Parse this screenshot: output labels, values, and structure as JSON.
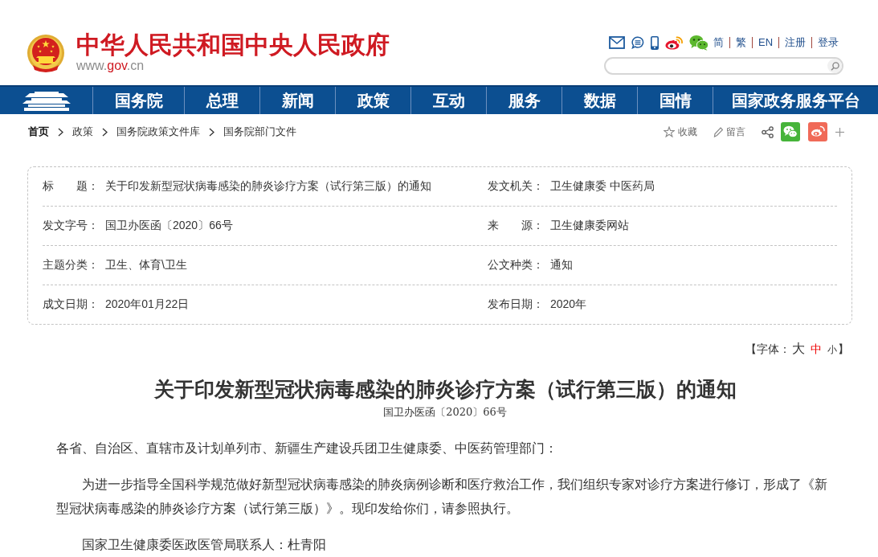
{
  "header": {
    "site_title": "中华人民共和国中央人民政府",
    "site_url": "www.gov.cn",
    "links": [
      "简",
      "繁",
      "EN",
      "注册",
      "登录"
    ]
  },
  "nav": {
    "items": [
      "国务院",
      "总理",
      "新闻",
      "政策",
      "互动",
      "服务",
      "数据",
      "国情",
      "国家政务服务平台"
    ]
  },
  "breadcrumb": {
    "items": [
      "首页",
      "政策",
      "国务院政策文件库",
      "国务院部门文件"
    ],
    "actions": [
      "收藏",
      "留言"
    ]
  },
  "info": {
    "rows": [
      {
        "fields": [
          {
            "label": "标　　题：",
            "value": "关于印发新型冠状病毒感染的肺炎诊疗方案（试行第三版）的通知"
          },
          {
            "label": "发文机关：",
            "value": "卫生健康委 中医药局"
          }
        ]
      },
      {
        "fields": [
          {
            "label": "发文字号：",
            "value": "国卫办医函〔2020〕66号"
          },
          {
            "label": "来　　源：",
            "value": "卫生健康委网站"
          }
        ]
      },
      {
        "fields": [
          {
            "label": "主题分类：",
            "value": "卫生、体育\\卫生"
          },
          {
            "label": "公文种类：",
            "value": "通知"
          }
        ]
      },
      {
        "fields": [
          {
            "label": "成文日期：",
            "value": "2020年01月22日"
          },
          {
            "label": "发布日期：",
            "value": "2020年"
          }
        ]
      }
    ]
  },
  "font_size": {
    "prefix": "【字体：",
    "options": [
      {
        "label": "大",
        "kind": "large",
        "selected": false
      },
      {
        "label": "中",
        "kind": "medium",
        "selected": true
      },
      {
        "label": "小",
        "kind": "small",
        "selected": false
      }
    ],
    "suffix": "】"
  },
  "article": {
    "title": "关于印发新型冠状病毒感染的肺炎诊疗方案（试行第三版）的通知",
    "doc_number": "国卫办医函〔2020〕66号",
    "paragraphs": [
      {
        "text": "各省、自治区、直辖市及计划单列市、新疆生产建设兵团卫生健康委、中医药管理部门：",
        "indent": false
      },
      {
        "text": "为进一步指导全国科学规范做好新型冠状病毒感染的肺炎病例诊断和医疗救治工作，我们组织专家对诊疗方案进行修订，形成了《新型冠状病毒感染的肺炎诊疗方案（试行第三版）》。现印发给你们，请参照执行。",
        "indent": true
      },
      {
        "text": "国家卫生健康委医政医管局联系人：杜青阳",
        "indent": true
      }
    ]
  }
}
